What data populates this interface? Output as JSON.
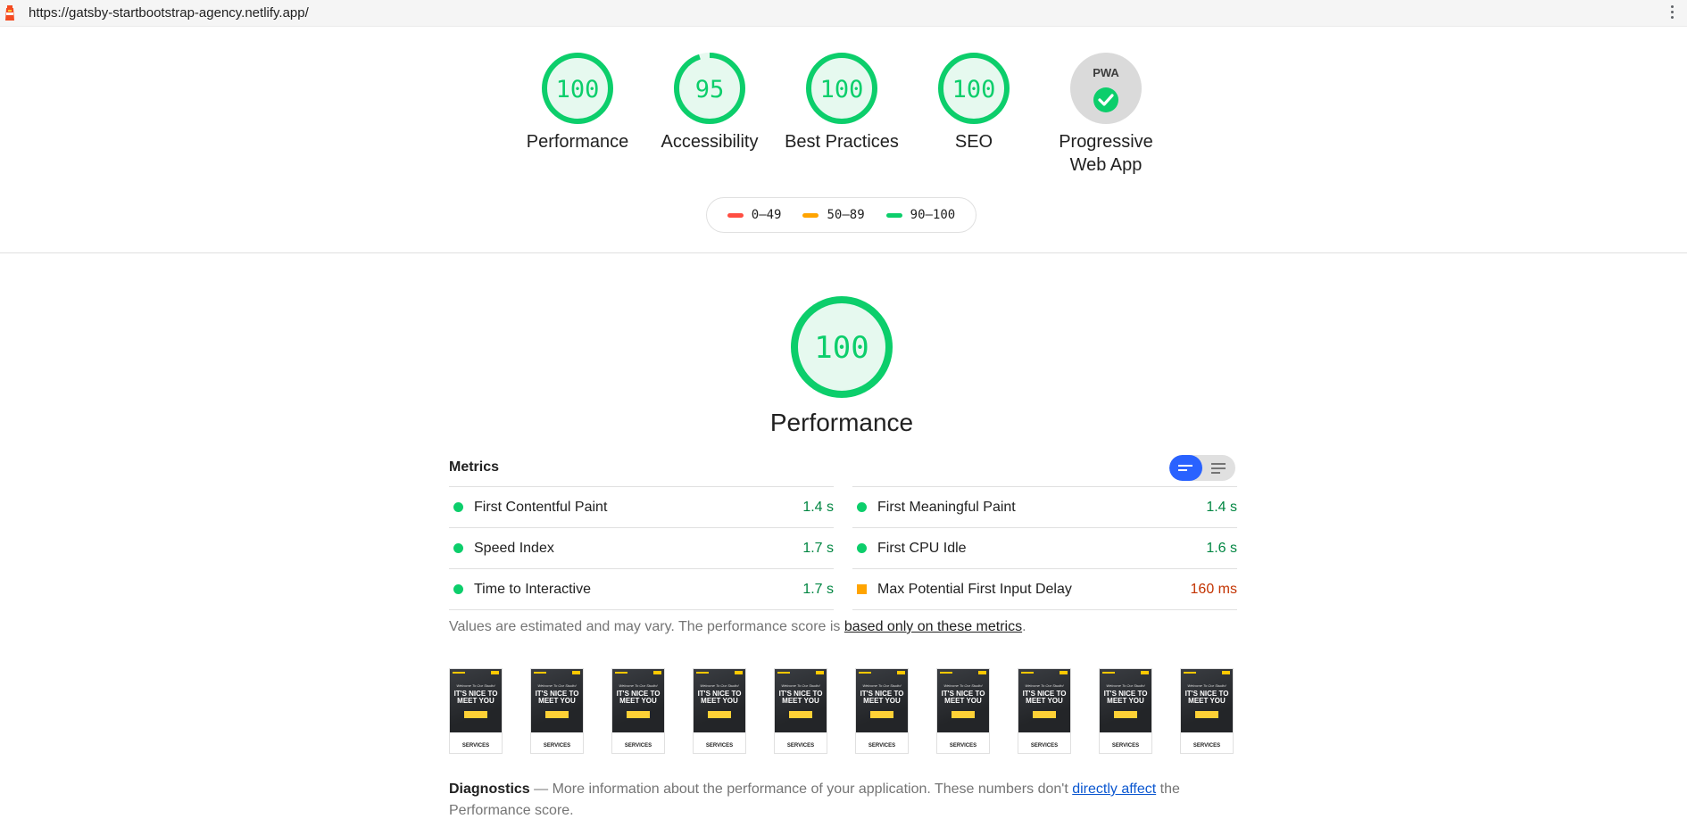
{
  "top_bar": {
    "url": "https://gatsby-startbootstrap-agency.netlify.app/"
  },
  "gauges": [
    {
      "score": "100",
      "label": "Performance"
    },
    {
      "score": "95",
      "label": "Accessibility"
    },
    {
      "score": "100",
      "label": "Best Practices"
    },
    {
      "score": "100",
      "label": "SEO"
    }
  ],
  "pwa": {
    "logo_text": "PWA",
    "label_line1": "Progressive",
    "label_line2": "Web App"
  },
  "legend": {
    "fail": "0–49",
    "average": "50–89",
    "pass": "90–100"
  },
  "colors": {
    "pass": "#0cce6b",
    "average": "#ffa400",
    "fail": "#ff4e42",
    "accent": "#2962ff"
  },
  "performance": {
    "score": "100",
    "title": "Performance"
  },
  "metrics": {
    "heading": "Metrics",
    "left": [
      {
        "name": "First Contentful Paint",
        "value": "1.4 s",
        "rating": "pass"
      },
      {
        "name": "Speed Index",
        "value": "1.7 s",
        "rating": "pass"
      },
      {
        "name": "Time to Interactive",
        "value": "1.7 s",
        "rating": "pass"
      }
    ],
    "right": [
      {
        "name": "First Meaningful Paint",
        "value": "1.4 s",
        "rating": "pass"
      },
      {
        "name": "First CPU Idle",
        "value": "1.6 s",
        "rating": "pass"
      },
      {
        "name": "Max Potential First Input Delay",
        "value": "160 ms",
        "rating": "average"
      }
    ]
  },
  "note": {
    "text": "Values are estimated and may vary. The performance score is ",
    "link": "based only on these metrics",
    "suffix": "."
  },
  "filmstrip": {
    "frame_subtitle": "Welcome To Our Studio!",
    "frame_title": "IT'S NICE TO MEET YOU",
    "frame_caption": "SERVICES",
    "frame_count": 10
  },
  "diagnostics": {
    "title": "Diagnostics",
    "text": " — More information about the performance of your application. These numbers don't ",
    "link": "directly affect",
    "suffix": " the Performance score."
  }
}
